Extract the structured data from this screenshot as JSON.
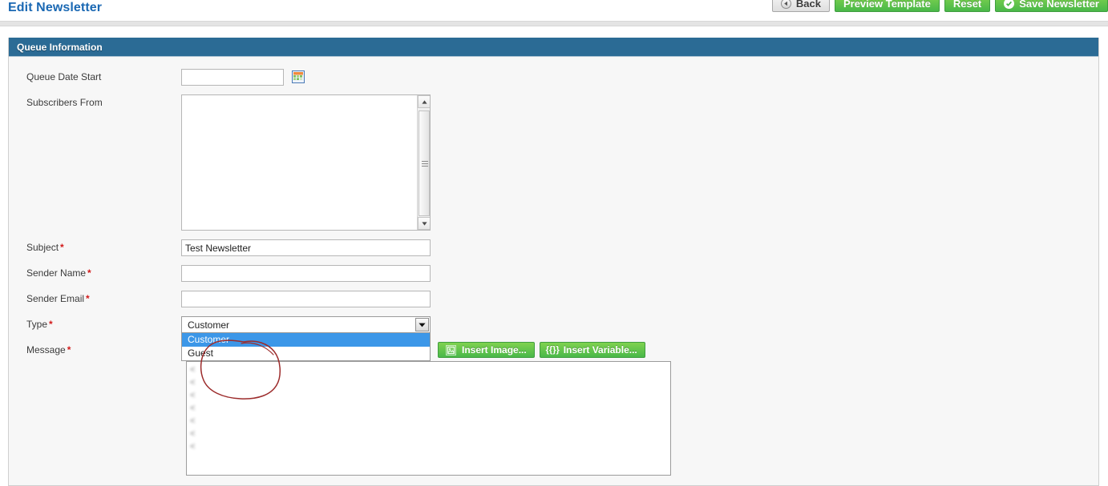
{
  "header": {
    "title": "Edit Newsletter",
    "buttons": [
      {
        "name": "back",
        "label": "Back",
        "icon": "back-arrow-icon",
        "style": "gray"
      },
      {
        "name": "preview-template",
        "label": "Preview Template",
        "icon": "",
        "style": "green"
      },
      {
        "name": "reset",
        "label": "Reset",
        "icon": "",
        "style": "green"
      },
      {
        "name": "save-newsletter",
        "label": "Save Newsletter",
        "icon": "check-circle-icon",
        "style": "green"
      }
    ]
  },
  "panel": {
    "heading": "Queue Information"
  },
  "form": {
    "queue_date_start": {
      "label": "Queue Date Start",
      "value": "",
      "placeholder": "",
      "calendar_icon": "calendar-icon"
    },
    "subscribers_from": {
      "label": "Subscribers From",
      "options": [
        "",
        "",
        "",
        "",
        "",
        "",
        "",
        "",
        "",
        "",
        "",
        "",
        ""
      ],
      "scrollbar": {
        "up_icon": "scroll-up-icon",
        "down_icon": "scroll-down-icon"
      }
    },
    "subject": {
      "label": "Subject",
      "required": "*",
      "value": "Test Newsletter",
      "placeholder": ""
    },
    "sender_name": {
      "label": "Sender Name",
      "required": "*",
      "value": "",
      "placeholder": ""
    },
    "sender_email": {
      "label": "Sender Email",
      "required": "*",
      "value": "",
      "placeholder": ""
    },
    "type": {
      "label": "Type",
      "required": "*",
      "selected": "Customer",
      "expanded": true,
      "options": [
        "Customer",
        "Guest"
      ],
      "dropdown_icon": "chevron-down-icon"
    },
    "message": {
      "label": "Message",
      "required": "*",
      "toolbar": [
        {
          "name": "insert-image",
          "label": "Insert Image...",
          "icon": "image-icon"
        },
        {
          "name": "insert-variable",
          "label": "Insert Variable...",
          "icon": "variable-icon"
        }
      ],
      "lines": [
        "<                                                       ",
        "<                                                       ",
        "<                                                       ",
        "<                                                       ",
        "<                                                       ",
        "<                                                       ",
        "<                                                       "
      ]
    }
  },
  "annotation": {
    "name": "red-ellipse-highlight",
    "color": "#9c2b2b",
    "target": "type-dropdown"
  },
  "colors": {
    "title_blue": "#1a68b3",
    "panel_header_blue": "#2b6b95",
    "button_green": "#49b849",
    "required_red": "#d21a1a",
    "select_highlight_blue": "#3c97e8",
    "annotation_red": "#9c2b2b"
  }
}
